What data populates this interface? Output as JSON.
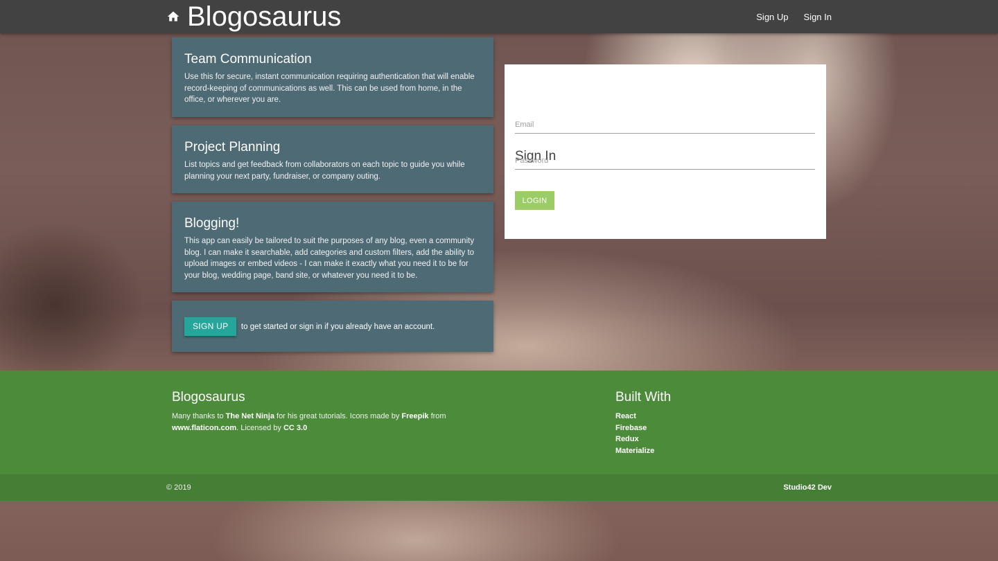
{
  "navbar": {
    "brand": "Blogosaurus",
    "home_icon": "home-icon",
    "links": [
      "Sign Up",
      "Sign In"
    ]
  },
  "cards": [
    {
      "title": "Team Communication",
      "body": "Use this for secure, instant communication requiring authentication that will enable record-keeping of communications as well. This can be used from home, in the office, or wherever you are."
    },
    {
      "title": "Project Planning",
      "body": "List topics and get feedback from collaborators on each topic to guide you while planning your next party, fundraiser, or company outing."
    },
    {
      "title": "Blogging!",
      "body": "This app can easily be tailored to suit the purposes of any blog, even a community blog. I can make it searchable, add categories and custom filters, add the ability to upload images or embed videos - I can make it exactly what you need it to be for your blog, wedding page, band site, or whatever you need it to be."
    }
  ],
  "cta": {
    "button": "Sign Up",
    "text": "to get started or sign in if you already have an account."
  },
  "signin": {
    "title": "Sign In",
    "email_placeholder": "Email",
    "email_value": "",
    "password_placeholder": "Password",
    "password_value": "",
    "button": "Login"
  },
  "footer": {
    "left_title": "Blogosaurus",
    "thanks_1": "Many thanks to ",
    "ninja": "The Net Ninja",
    "thanks_2": " for his great tutorials. Icons made by ",
    "freepik": "Freepik",
    "thanks_3": " from ",
    "flaticon": "www.flaticon.com",
    "thanks_4": ". Licensed by ",
    "license": "CC 3.0",
    "right_title": "Built With",
    "built_with": [
      "React",
      "Firebase",
      "Redux",
      "Materialize"
    ],
    "copyright": "© 2019",
    "studio": "Studio42 Dev"
  },
  "colors": {
    "navbar": "#424242",
    "card": "#4d6a75",
    "signup_button": "#26a69a",
    "login_button": "#9ccc65",
    "footer": "#4c8b3a",
    "footer_copyright": "#447f35"
  }
}
